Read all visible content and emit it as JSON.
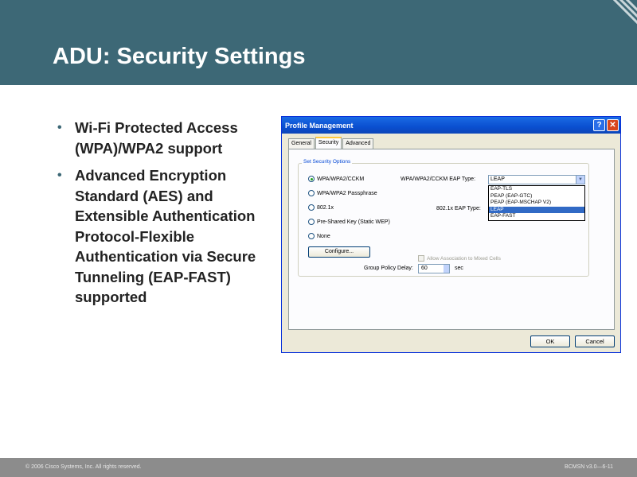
{
  "slide": {
    "title": "ADU: Security Settings",
    "bullets": [
      "Wi-Fi Protected Access (WPA)/WPA2 support",
      "Advanced Encryption Standard (AES) and Extensible Authentication Protocol-Flexible Authentication via Secure Tunneling (EAP-FAST) supported"
    ]
  },
  "dialog": {
    "title": "Profile Management",
    "help_icon": "help-icon",
    "close_icon": "close-icon",
    "tabs": [
      "General",
      "Security",
      "Advanced"
    ],
    "active_tab": "Security",
    "group_title": "Set Security Options",
    "options": [
      {
        "label": "WPA/WPA2/CCKM",
        "checked": true
      },
      {
        "label": "WPA/WPA2 Passphrase",
        "checked": false
      },
      {
        "label": "802.1x",
        "checked": false
      },
      {
        "label": "Pre-Shared Key (Static WEP)",
        "checked": false
      },
      {
        "label": "None",
        "checked": false
      }
    ],
    "eap_type_label": "WPA/WPA2/CCKM EAP Type:",
    "eap_type_value": "LEAP",
    "eap_list": [
      "EAP-TLS",
      "PEAP (EAP-GTC)",
      "PEAP (EAP-MSCHAP V2)",
      "LEAP",
      "EAP-FAST"
    ],
    "eap_selected_index": 3,
    "dot1x_label": "802.1x EAP Type:",
    "configure_label": "Configure...",
    "mixed_cells_label": "Allow Association to Mixed Cells",
    "group_policy_label": "Group Policy Delay:",
    "group_policy_value": "60",
    "group_policy_unit": "sec",
    "ok_label": "OK",
    "cancel_label": "Cancel"
  },
  "footer": {
    "copyright": "© 2006 Cisco Systems, Inc. All rights reserved.",
    "course": "BCMSN v3.0—6-11"
  },
  "colors": {
    "header_bg": "#3d6876",
    "footer_bg": "#8c8c8c",
    "titlebar_blue": "#0a4fd0",
    "selection_blue": "#316ac5"
  }
}
